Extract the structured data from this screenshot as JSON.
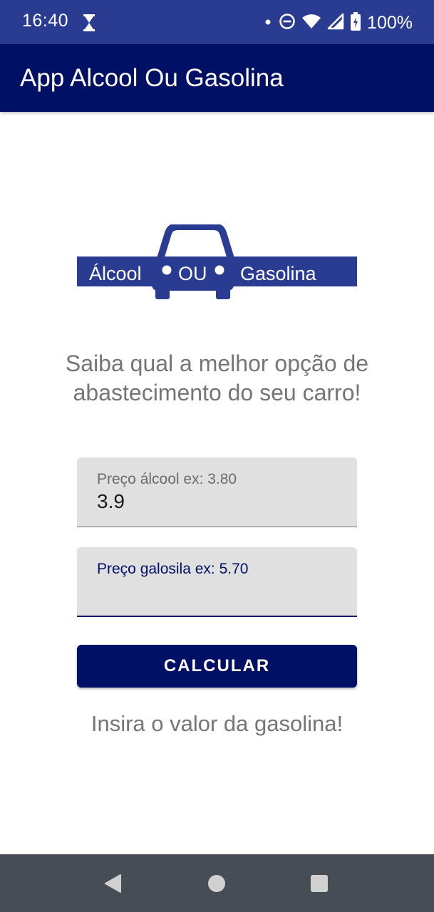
{
  "status_bar": {
    "time": "16:40",
    "battery": "100%",
    "icons": [
      "hourglass-icon",
      "dot-icon",
      "do-not-disturb-icon",
      "wifi-icon",
      "signal-icon",
      "battery-charging-icon"
    ]
  },
  "app_bar": {
    "title": "App Alcool Ou Gasolina"
  },
  "logo": {
    "left_word": "Álcool",
    "middle_word": "OU",
    "right_word": "Gasolina",
    "color": "#2a3c92"
  },
  "headline": "Saiba qual a melhor opção de abastecimento do seu carro!",
  "fields": {
    "alcool": {
      "label": "Preço álcool ex: 3.80",
      "value": "3.9"
    },
    "gasolina": {
      "label": "Preço galosila ex: 5.70",
      "value": ""
    }
  },
  "button": {
    "label": "CALCULAR"
  },
  "result": "Insira o valor da gasolina!",
  "colors": {
    "status_bar": "#2a3c92",
    "primary": "#001064",
    "field_bg": "#e0e0e0",
    "text_grey": "#757575",
    "nav_bar": "#474d55"
  },
  "nav_bar": {
    "icons": [
      "back-icon",
      "home-icon",
      "recents-icon"
    ]
  }
}
